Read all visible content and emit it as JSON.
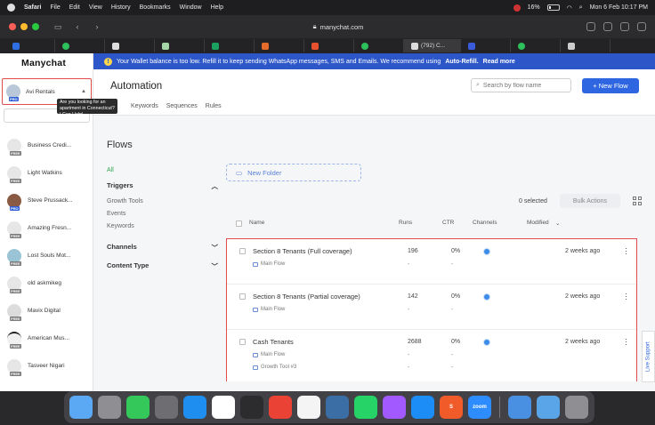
{
  "menubar": {
    "items": [
      "Safari",
      "File",
      "Edit",
      "View",
      "History",
      "Bookmarks",
      "Window",
      "Help"
    ],
    "battery": "16%",
    "datetime": "Mon 6 Feb  10:17 PM"
  },
  "browser": {
    "url": "manychat.com",
    "active_tab_label": "(792) C..."
  },
  "sidebar": {
    "logo": "Manychat",
    "current_account": {
      "name": "Avi Rentals",
      "plan": "PRO"
    },
    "tooltip": "Are you looking for an apartment in Connecticut? I Can Help!",
    "accounts": [
      {
        "name": "Business Credi...",
        "plan": "FREE"
      },
      {
        "name": "Light Watkins",
        "plan": "FREE"
      },
      {
        "name": "Steve Prussack...",
        "plan": "PRO"
      },
      {
        "name": "Amazing Fresn...",
        "plan": "FREE"
      },
      {
        "name": "Lost Souls Mot...",
        "plan": "FREE"
      },
      {
        "name": "old askmikeg",
        "plan": "FREE"
      },
      {
        "name": "Mavix Digital",
        "plan": "FREE"
      },
      {
        "name": "American Mus...",
        "plan": "FREE"
      },
      {
        "name": "Tasveer Nigari",
        "plan": "FREE"
      }
    ]
  },
  "banner": {
    "text": "Your Wallet balance is too low. Refill it to keep sending WhatsApp messages, SMS and Emails. We recommend using",
    "link": "Auto-Refill.",
    "more": "Read more"
  },
  "header": {
    "title": "Automation",
    "subtabs": [
      "Keywords",
      "Sequences",
      "Rules"
    ],
    "search_placeholder": "Search by flow name",
    "new_flow": "+ New Flow"
  },
  "flows": {
    "title": "Flows",
    "nav": {
      "all": "All",
      "triggers": "Triggers",
      "trigger_items": [
        "Growth Tools",
        "Events",
        "Keywords"
      ],
      "channels": "Channels",
      "content_type": "Content Type"
    },
    "new_folder": "New Folder",
    "selected": "0 selected",
    "bulk_actions": "Bulk Actions",
    "columns": {
      "name": "Name",
      "runs": "Runs",
      "ctr": "CTR",
      "channels": "Channels",
      "modified": "Modified"
    },
    "rows": [
      {
        "name": "Section 8 Tenants (Full coverage)",
        "sub": [
          "Main Flow"
        ],
        "runs": "196",
        "ctr": "0%",
        "modified": "2 weeks ago"
      },
      {
        "name": "Section 8 Tenants (Partial coverage)",
        "sub": [
          "Main Flow"
        ],
        "runs": "142",
        "ctr": "0%",
        "modified": "2 weeks ago"
      },
      {
        "name": "Cash Tenants",
        "sub": [
          "Main Flow",
          "Growth Tool #3"
        ],
        "runs": "2688",
        "ctr": "0%",
        "modified": "2 weeks ago"
      }
    ],
    "dash": "-",
    "live_support": "Live Support"
  },
  "dock": {
    "zoom_label": "zoom",
    "scribd_label": "S"
  }
}
